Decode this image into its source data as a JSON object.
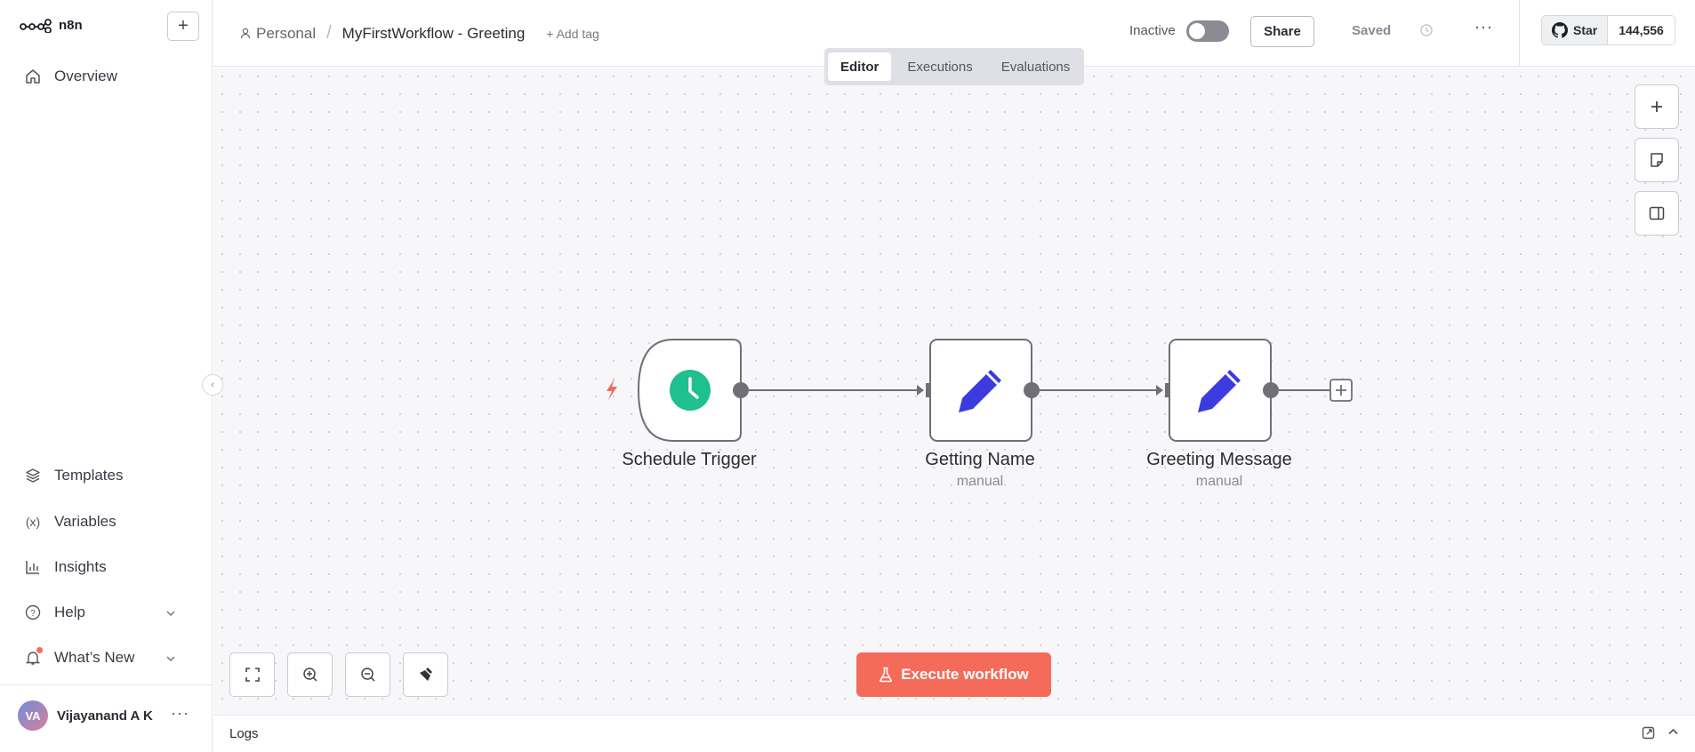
{
  "brand": {
    "name": "n8n"
  },
  "sidebar": {
    "top_items": [
      {
        "label": "Overview",
        "icon": "home-icon"
      }
    ],
    "bottom_items": [
      {
        "label": "Templates",
        "icon": "templates-icon"
      },
      {
        "label": "Variables",
        "icon": "variables-icon"
      },
      {
        "label": "Insights",
        "icon": "insights-icon"
      },
      {
        "label": "Help",
        "icon": "help-icon"
      },
      {
        "label": "What’s New",
        "icon": "bell-icon"
      }
    ],
    "user": {
      "initials": "VA",
      "name": "Vijayanand A K"
    }
  },
  "header": {
    "project": "Personal",
    "workflow_name": "MyFirstWorkflow - Greeting",
    "add_tag": "+ Add tag",
    "status": "Inactive",
    "share": "Share",
    "saved": "Saved",
    "github": {
      "star": "Star",
      "count": "144,556"
    }
  },
  "tabs": [
    {
      "label": "Editor",
      "active": true
    },
    {
      "label": "Executions",
      "active": false
    },
    {
      "label": "Evaluations",
      "active": false
    }
  ],
  "nodes": [
    {
      "label": "Schedule Trigger",
      "sub": "",
      "type": "trigger",
      "icon": "clock-icon"
    },
    {
      "label": "Getting Name",
      "sub": "manual",
      "type": "set",
      "icon": "pencil-icon"
    },
    {
      "label": "Greeting Message",
      "sub": "manual",
      "type": "set",
      "icon": "pencil-icon"
    }
  ],
  "execute_button": "Execute workflow",
  "logs": {
    "label": "Logs"
  },
  "colors": {
    "accent": "#f46b5a",
    "trigger": "#1fbf8f",
    "pencil": "#3b3be0"
  }
}
